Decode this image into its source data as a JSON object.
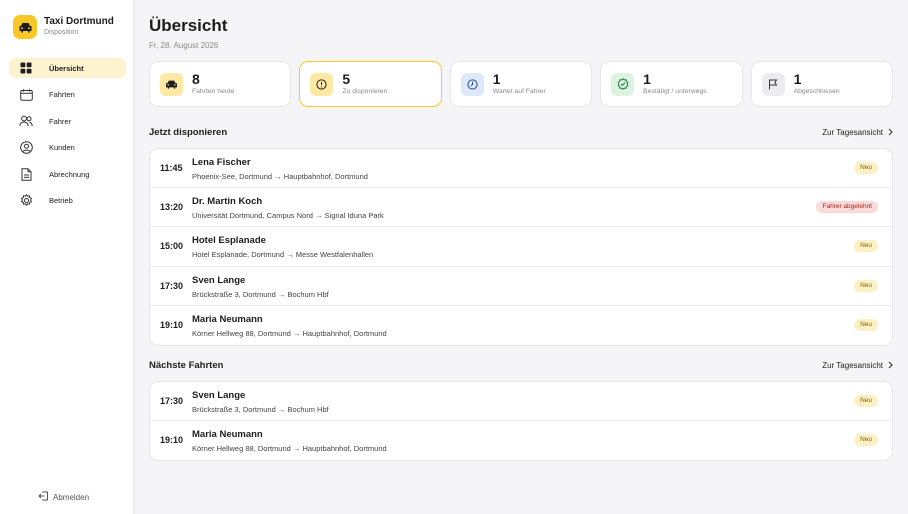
{
  "app": {
    "name": "Taxi Dortmund",
    "subtitle": "Disposition",
    "accent": "#f7c826"
  },
  "sidebar": {
    "items": [
      {
        "label": "Übersicht",
        "icon": "grid-icon",
        "active": true
      },
      {
        "label": "Fahrten",
        "icon": "calendar-icon",
        "active": false
      },
      {
        "label": "Fahrer",
        "icon": "users-icon",
        "active": false
      },
      {
        "label": "Kunden",
        "icon": "user-circle-icon",
        "active": false
      },
      {
        "label": "Abrechnung",
        "icon": "document-icon",
        "active": false
      },
      {
        "label": "Betrieb",
        "icon": "gear-icon",
        "active": false
      }
    ],
    "logout_label": "Abmelden"
  },
  "header": {
    "title": "Übersicht",
    "date": "Fr, 28. August 2026"
  },
  "stats": [
    {
      "value": "8",
      "label": "Fahrten heute",
      "icon": "car-icon",
      "icon_bg": "#fde9a4"
    },
    {
      "value": "5",
      "label": "Zu disponieren",
      "icon": "alert-icon",
      "icon_bg": "#fde9a4"
    },
    {
      "value": "1",
      "label": "Wartet auf Fahrer",
      "icon": "clock-icon",
      "icon_bg": "#dde8fb"
    },
    {
      "value": "1",
      "label": "Bestätigt / unterwegs",
      "icon": "check-icon",
      "icon_bg": "#dcf3e2"
    },
    {
      "value": "1",
      "label": "Abgeschlossen",
      "icon": "flag-icon",
      "icon_bg": "#ececf0"
    }
  ],
  "dispatch": {
    "title": "Jetzt disponieren",
    "link": "Zur Tagesansicht",
    "rows": [
      {
        "time": "11:45",
        "name": "Lena Fischer",
        "route": "Phoenix-See, Dortmund → Hauptbahnhof, Dortmund",
        "badge": "Neu",
        "badge_type": "neu"
      },
      {
        "time": "13:20",
        "name": "Dr. Martin Koch",
        "route": "Universität Dortmund, Campus Nord → Signal Iduna Park",
        "badge": "Fahrer abgelehnt",
        "badge_type": "warn"
      },
      {
        "time": "15:00",
        "name": "Hotel Esplanade",
        "route": "Hotel Esplanade, Dortmund → Messe Westfalenhallen",
        "badge": "Neu",
        "badge_type": "neu"
      },
      {
        "time": "17:30",
        "name": "Sven Lange",
        "route": "Brückstraße 3, Dortmund → Bochum Hbf",
        "badge": "Neu",
        "badge_type": "neu"
      },
      {
        "time": "19:10",
        "name": "Maria Neumann",
        "route": "Körner Hellweg 88, Dortmund → Hauptbahnhof, Dortmund",
        "badge": "Neu",
        "badge_type": "neu"
      }
    ]
  },
  "upcoming": {
    "title": "Nächste Fahrten",
    "link": "Zur Tagesansicht",
    "rows": [
      {
        "time": "17:30",
        "name": "Sven Lange",
        "route": "Brückstraße 3, Dortmund → Bochum Hbf",
        "badge": "Neu",
        "badge_type": "neu"
      },
      {
        "time": "19:10",
        "name": "Maria Neumann",
        "route": "Körner Hellweg 88, Dortmund → Hauptbahnhof, Dortmund",
        "badge": "Neu",
        "badge_type": "neu"
      }
    ]
  }
}
